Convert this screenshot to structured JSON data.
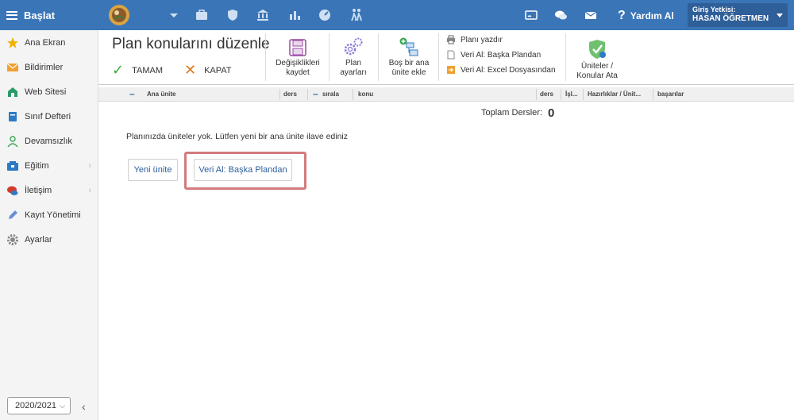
{
  "topbar": {
    "start_label": "Başlat",
    "help_label": "Yardım Al",
    "user_role_label": "Giriş Yetkisi:",
    "user_name": "HASAN ÖĞRETMEN"
  },
  "sidebar": {
    "items": [
      {
        "label": "Ana Ekran",
        "icon": "star-icon"
      },
      {
        "label": "Bildirimler",
        "icon": "envelope-icon"
      },
      {
        "label": "Web Sitesi",
        "icon": "home-icon"
      },
      {
        "label": "Sınıf Defteri",
        "icon": "book-icon"
      },
      {
        "label": "Devamsızlık",
        "icon": "person-icon"
      },
      {
        "label": "Eğitim",
        "icon": "graduation-icon"
      },
      {
        "label": "İletişim",
        "icon": "chat-icon"
      },
      {
        "label": "Kayıt Yönetimi",
        "icon": "pencil-icon"
      },
      {
        "label": "Ayarlar",
        "icon": "gear-icon"
      }
    ],
    "year": "2020/2021"
  },
  "main": {
    "title": "Plan konularını düzenle",
    "ok_label": "TAMAM",
    "close_label": "KAPAT",
    "tools": {
      "save": [
        "Değişiklikleri",
        "kaydet"
      ],
      "settings": [
        "Plan",
        "ayarları"
      ],
      "add_unit": [
        "Boş bir ana",
        "ünite ekle"
      ],
      "print": "Planı yazdır",
      "import_plan": "Veri Al: Başka Plandan",
      "import_excel": "Veri Al: Excel Dosyasından",
      "assign": [
        "Üniteler /",
        "Konular Ata"
      ]
    },
    "table_headers": {
      "unit": "Ana ünite",
      "lessons": "ders",
      "order": "sırala",
      "topic": "konu",
      "lessons2": "ders",
      "op": "İşl...",
      "prep": "Hazırlıklar / Ünit...",
      "success": "başarılar"
    },
    "total_label": "Toplam Dersler:",
    "total_value": "0",
    "empty_message": "Planınızda üniteler yok. Lütfen yeni bir ana ünite ilave ediniz",
    "new_unit_button": "Yeni ünite",
    "import_button": "Veri Al: Başka Plandan"
  },
  "colors": {
    "topbar": "#3a75b7",
    "accent_text": "#2d5f9b",
    "highlight": "#d27c7c"
  }
}
